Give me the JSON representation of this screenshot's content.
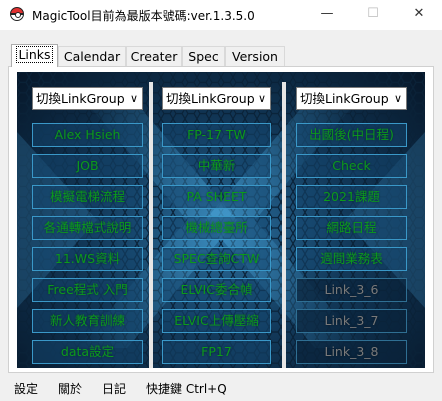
{
  "window": {
    "title": "MagicTool目前為最版本號碼:ver.1.3.5.0",
    "minimize": "—",
    "maximize": "☐",
    "close": "✕"
  },
  "tabs": [
    "Links",
    "Calendar",
    "Creater",
    "Spec",
    "Version"
  ],
  "dropdowns": [
    "切換LinkGroup",
    "切換LinkGroup",
    "切換LinkGroup"
  ],
  "columns": [
    [
      "Alex Hsieh",
      "JOB",
      "模擬電梯流程",
      "各通轉檔式說明",
      "11.WS資料",
      "Free程式 入門",
      "新人教育訓練",
      "data設定"
    ],
    [
      "FP-17 TW",
      "中華新",
      "PA SHEET",
      "機械總臺所",
      "SPEC查詢CTW",
      "ELVIC委合幀",
      "ELVIC上傳壓縮",
      "FP17"
    ],
    [
      "出國後(中日程)",
      "Check",
      "2021課題",
      "網路日程",
      "週間業務表",
      "Link_3_6",
      "Link_3_7",
      "Link_3_8"
    ]
  ],
  "menu": [
    "設定",
    "關於",
    "日記",
    "快捷鍵 Ctrl+Q"
  ],
  "colors": {
    "link_text": "#0c9a1c",
    "link_disabled": "#7a7a7a",
    "link_border": "#3a98c8",
    "background_dark": "#061628"
  }
}
